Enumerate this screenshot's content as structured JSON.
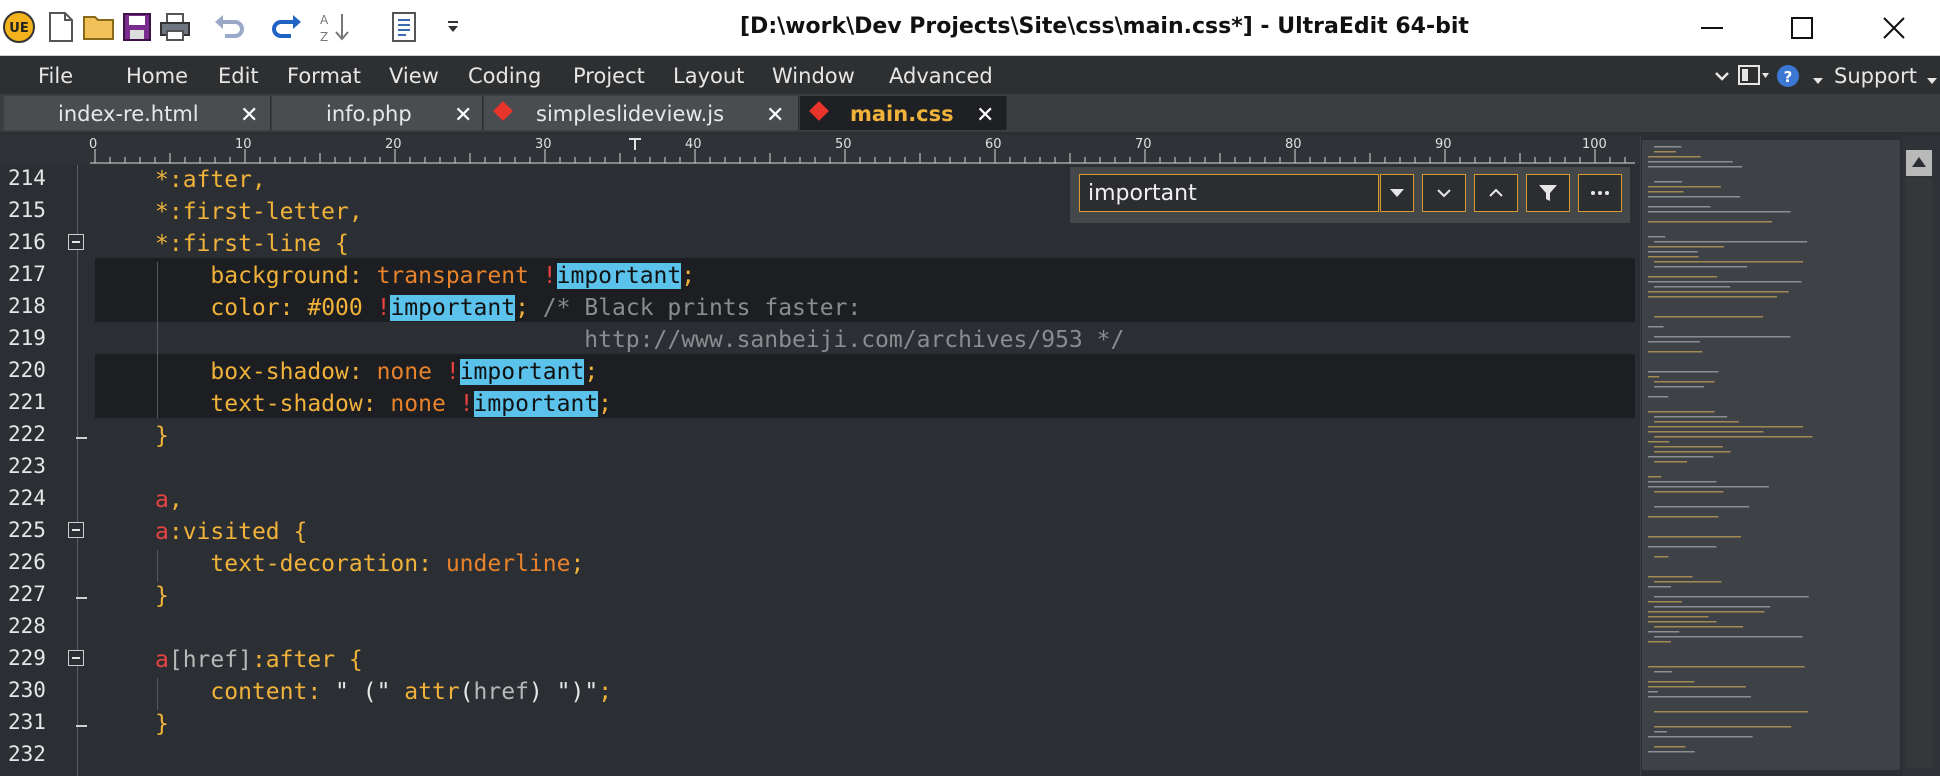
{
  "window": {
    "title": "[D:\\work\\Dev Projects\\Site\\css\\main.css*] - UltraEdit 64-bit",
    "app_logo": "UE"
  },
  "menu": {
    "items": [
      "File",
      "Home",
      "Edit",
      "Format",
      "View",
      "Coding",
      "Project",
      "Layout",
      "Window",
      "Advanced"
    ],
    "support_label": "Support"
  },
  "tabs": [
    {
      "label": "index-re.html",
      "modified": false,
      "active": false
    },
    {
      "label": "info.php",
      "modified": false,
      "active": false
    },
    {
      "label": "simpleslideview.js",
      "modified": true,
      "active": false
    },
    {
      "label": "main.css",
      "modified": true,
      "active": true
    }
  ],
  "ruler": {
    "labels": [
      "0",
      "10",
      "20",
      "30",
      "40",
      "50",
      "60",
      "70",
      "80",
      "90",
      "100"
    ]
  },
  "find": {
    "query": "important"
  },
  "editor": {
    "line_numbers": [
      "214",
      "215",
      "216",
      "217",
      "218",
      "219",
      "220",
      "221",
      "222",
      "223",
      "224",
      "225",
      "226",
      "227",
      "228",
      "229",
      "230",
      "231",
      "232"
    ],
    "lines": [
      "*:after,",
      "*:first-letter,",
      "*:first-line {",
      "    background: transparent !important;",
      "    color: #000 !important; /* Black prints faster:",
      "                               http://www.sanbeiji.com/archives/953 */",
      "    box-shadow: none !important;",
      "    text-shadow: none !important;",
      "}",
      "",
      "a,",
      "a:visited {",
      "    text-decoration: underline;",
      "}",
      "",
      "a[href]:after {",
      "    content: \" (\" attr(href) \")\";",
      "}",
      ""
    ],
    "tokens": {
      "l214_a": "*:after,",
      "l215_a": "*:first-letter,",
      "l216_a": "*:first-line {",
      "l217_prop": "background:",
      "l217_val": "transparent",
      "l217_bang": "!",
      "l217_hit": "important",
      "l217_semi": ";",
      "l218_prop": "color:",
      "l218_val": "#000",
      "l218_bang": "!",
      "l218_hit": "important",
      "l218_semi": ";",
      "l218_comment": "/* Black prints faster:",
      "l219_comment": "http://www.sanbeiji.com/archives/953 */",
      "l220_prop": "box-shadow:",
      "l220_val": "none",
      "l220_bang": "!",
      "l220_hit": "important",
      "l220_semi": ";",
      "l221_prop": "text-shadow:",
      "l221_val": "none",
      "l221_bang": "!",
      "l221_hit": "important",
      "l221_semi": ";",
      "l222_brace": "}",
      "l224_sel": "a",
      "l224_comma": ",",
      "l225_sel": "a",
      "l225_rest": ":visited {",
      "l226_prop": "text-decoration:",
      "l226_val": "underline",
      "l226_semi": ";",
      "l227_brace": "}",
      "l229_sel": "a",
      "l229_attr": "[href]",
      "l229_rest": ":after {",
      "l230_prop": "content:",
      "l230_str1": "\" (\"",
      "l230_fn": "attr",
      "l230_open": "(",
      "l230_arg": "href",
      "l230_close": ")",
      "l230_str2": "\")\"",
      "l230_semi": ";",
      "l231_brace": "}"
    }
  },
  "colors": {
    "editor_bg": "#2b2f33",
    "keyword": "#f0b23a",
    "value": "#e8822b",
    "selector_element": "#e84343",
    "comment": "#8a8d90",
    "search_hit": "#5bc2ec",
    "active_tab_text": "#f0b23a"
  }
}
